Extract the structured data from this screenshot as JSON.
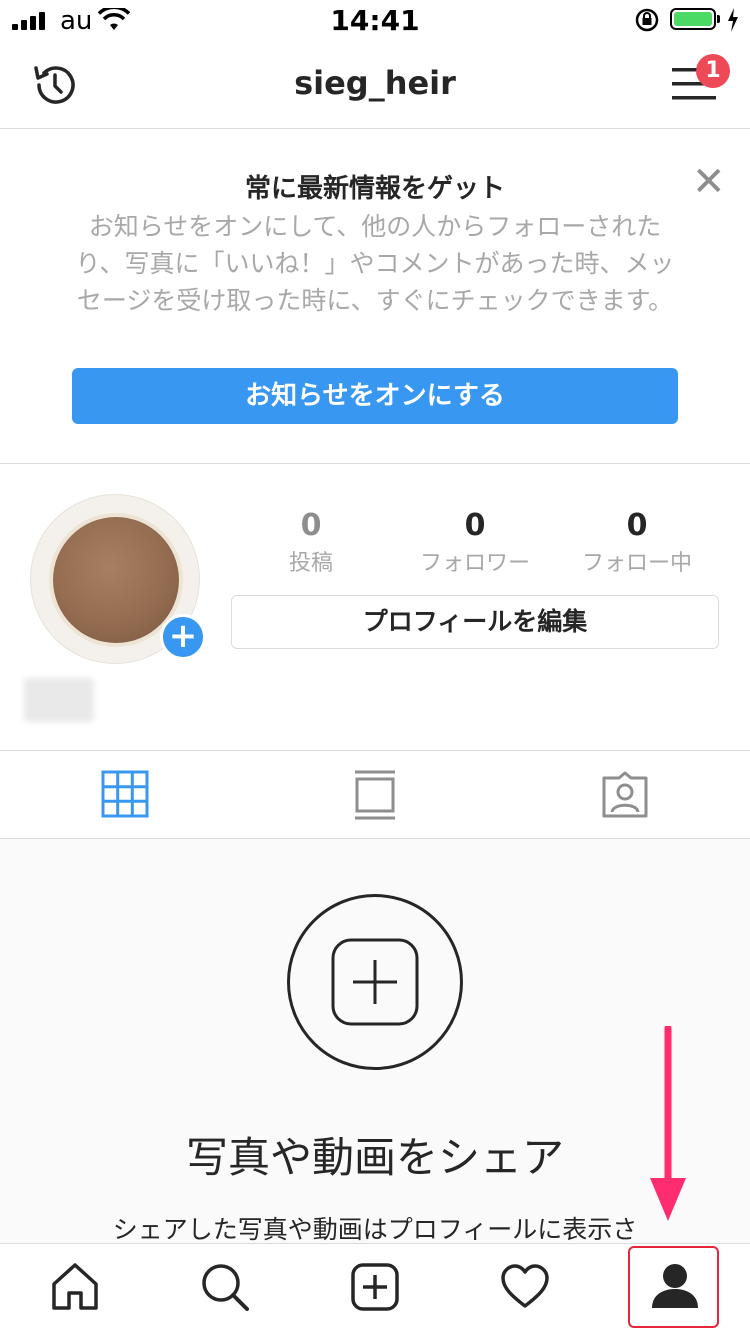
{
  "status_bar": {
    "carrier": "au",
    "time": "14:41"
  },
  "header": {
    "username": "sieg_heir",
    "menu_badge": "1"
  },
  "notification": {
    "title": "常に最新情報をゲット",
    "body": "お知らせをオンにして、他の人からフォローされたり、写真に「いいね！」やコメントがあった時、メッセージを受け取った時に、すぐにチェックできます。",
    "button_label": "お知らせをオンにする",
    "close_glyph": "✕"
  },
  "profile": {
    "stats": [
      {
        "value": "0",
        "label": "投稿"
      },
      {
        "value": "0",
        "label": "フォロワー"
      },
      {
        "value": "0",
        "label": "フォロー中"
      }
    ],
    "edit_button_label": "プロフィールを編集",
    "add_glyph": "+"
  },
  "profile_tabs": [
    "grid-icon",
    "feed-icon",
    "tagged-icon"
  ],
  "empty_state": {
    "title": "写真や動画をシェア",
    "subtitle": "シェアした写真や動画はプロフィールに表示さ"
  },
  "tab_bar": [
    "home-icon",
    "search-icon",
    "add-post-icon",
    "activity-heart-icon",
    "profile-icon"
  ],
  "colors": {
    "accent_blue": "#3897f0",
    "badge_red": "#ed4956",
    "annotation_pink": "#ff2d6f",
    "highlight_red": "#e7263c"
  }
}
